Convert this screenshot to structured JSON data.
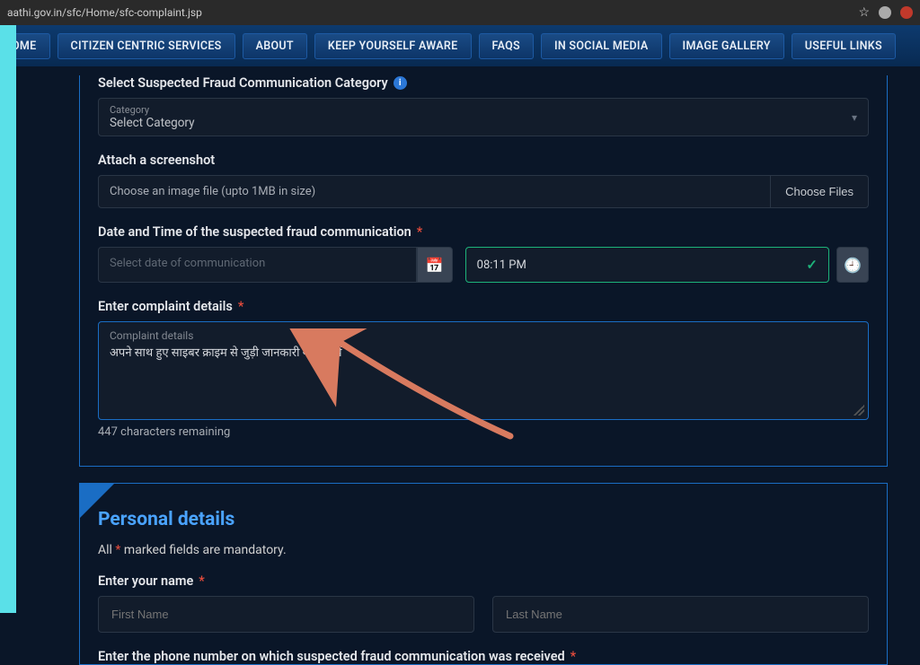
{
  "browser": {
    "url": "aathi.gov.in/sfc/Home/sfc-complaint.jsp"
  },
  "nav": {
    "items": [
      "ome",
      "Citizen Centric Services",
      "About",
      "Keep Yourself Aware",
      "FAQs",
      "In Social Media",
      "Image Gallery",
      "Useful Links"
    ]
  },
  "form": {
    "category": {
      "label": "Select Suspected Fraud Communication Category",
      "hintLabel": "Category",
      "value": "Select Category"
    },
    "screenshot": {
      "label": "Attach a screenshot",
      "placeholder": "Choose an image file (upto 1MB in size)",
      "button": "Choose Files"
    },
    "datetime": {
      "label": "Date and Time of the suspected fraud communication",
      "datePlaceholder": "Select date of communication",
      "timeValue": "08:11 PM"
    },
    "complaint": {
      "label": "Enter complaint details",
      "placeholder": "Complaint details",
      "value": "अपने साथ हुए साइबर क्राइम से जुड़ी जानकारी यहाँ लिखें",
      "remaining": "447 characters remaining"
    }
  },
  "personal": {
    "title": "Personal details",
    "note_pre": "All ",
    "note_post": " marked fields are mandatory.",
    "nameLabel": "Enter your name",
    "firstPlaceholder": "First Name",
    "lastPlaceholder": "Last Name",
    "phoneLabel": "Enter the phone number on which suspected fraud communication was received"
  }
}
